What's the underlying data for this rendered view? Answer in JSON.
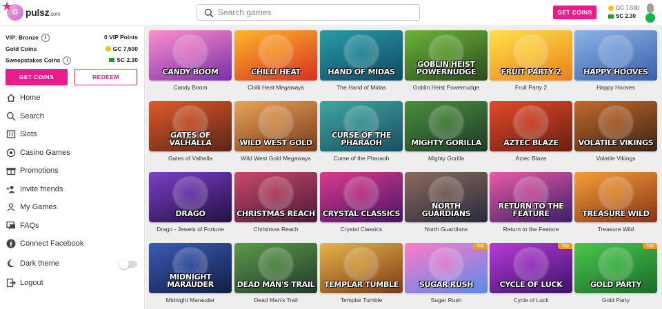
{
  "brand": {
    "logo_text": "pulsz",
    "logo_suffix": ".com",
    "logo_letter": "G"
  },
  "header": {
    "search_placeholder": "Search games",
    "get_coins_label": "GET COINS",
    "gc_balance": "GC 7,500",
    "sc_balance": "SC 2.30"
  },
  "sidebar": {
    "vip_label": "VIP: Bronze",
    "vip_points": "0 VIP Points",
    "gold_label": "Gold Coins",
    "gold_value": "GC 7,500",
    "sweeps_label": "Sweepstakes Coins",
    "sweeps_value": "SC 2.30",
    "get_coins_label": "GET COINS",
    "redeem_label": "REDEEM",
    "items": [
      {
        "label": "Home",
        "icon": "home-icon"
      },
      {
        "label": "Search",
        "icon": "search-icon"
      },
      {
        "label": "Slots",
        "icon": "slots-icon"
      },
      {
        "label": "Casino Games",
        "icon": "casino-chip-icon"
      },
      {
        "label": "Promotions",
        "icon": "gift-icon"
      },
      {
        "label": "Invite friends",
        "icon": "add-user-icon"
      },
      {
        "label": "My Games",
        "icon": "user-icon"
      },
      {
        "label": "FAQs",
        "icon": "faq-icon"
      },
      {
        "label": "Connect Facebook",
        "icon": "facebook-icon"
      },
      {
        "label": "Dark theme",
        "icon": "moon-icon"
      },
      {
        "label": "Logout",
        "icon": "logout-icon"
      }
    ]
  },
  "games": [
    {
      "name": "Candy Boom",
      "title": "CANDY BOOM",
      "bg": [
        "#ff8ecf",
        "#7a2fa8"
      ]
    },
    {
      "name": "Chilli Heat Megaways",
      "title": "CHILLI HEAT",
      "bg": [
        "#ffb52e",
        "#d6321d"
      ]
    },
    {
      "name": "The Hand of Midas",
      "title": "HAND OF MIDAS",
      "bg": [
        "#2a9ba6",
        "#0c4a63"
      ]
    },
    {
      "name": "Goblin Heist Powernudge",
      "title": "GOBLIN HEIST POWERNUDGE",
      "bg": [
        "#6bb53a",
        "#2b4a1a"
      ]
    },
    {
      "name": "Fruit Party 2",
      "title": "FRUIT PARTY 2",
      "bg": [
        "#ffe24a",
        "#e9821a"
      ]
    },
    {
      "name": "Happy Hooves",
      "title": "HAPPY HOOVES",
      "bg": [
        "#8bb4e8",
        "#3a5ea8"
      ]
    },
    {
      "name": "Gates of Valhalla",
      "title": "GATES OF VALHALLA",
      "bg": [
        "#e0582b",
        "#5a2616"
      ]
    },
    {
      "name": "Wild West Gold Megaways",
      "title": "WILD WEST GOLD",
      "bg": [
        "#e8a45a",
        "#7a3a1c"
      ]
    },
    {
      "name": "Curse of the Pharaoh",
      "title": "CURSE OF THE PHARAOH",
      "bg": [
        "#3fa6a0",
        "#1a4e63"
      ]
    },
    {
      "name": "Mighty Gorilla",
      "title": "MIGHTY GORILLA",
      "bg": [
        "#4a8f3c",
        "#1f3a2a"
      ]
    },
    {
      "name": "Aztec Blaze",
      "title": "AZTEC BLAZE",
      "bg": [
        "#e2492b",
        "#6a1f12"
      ]
    },
    {
      "name": "Volatile Vikings",
      "title": "VOLATILE VIKINGS",
      "bg": [
        "#c26a2c",
        "#3e2316"
      ]
    },
    {
      "name": "Drago - Jewels of Fortune",
      "title": "DRAGO",
      "bg": [
        "#7a3fc6",
        "#231044"
      ]
    },
    {
      "name": "Christmas Reach",
      "title": "CHRISTMAS REACH",
      "bg": [
        "#c9486a",
        "#4a1a3a"
      ]
    },
    {
      "name": "Crystal Classics",
      "title": "CRYSTAL CLASSICS",
      "bg": [
        "#d93a8c",
        "#4a1468"
      ]
    },
    {
      "name": "North Guardians",
      "title": "NORTH GUARDIANS",
      "bg": [
        "#8a6a5c",
        "#2a2a3e"
      ]
    },
    {
      "name": "Return to the Feature",
      "title": "RETURN TO THE FEATURE",
      "bg": [
        "#e95aa6",
        "#3a1f6a"
      ]
    },
    {
      "name": "Treasure Wild",
      "title": "TREASURE WILD",
      "bg": [
        "#f2a03a",
        "#8a3214"
      ]
    },
    {
      "name": "Midnight Marauder",
      "title": "MIDNIGHT MARAUDER",
      "bg": [
        "#3a5ab8",
        "#141e44"
      ]
    },
    {
      "name": "Dead Man's Trail",
      "title": "DEAD MAN'S TRAIL",
      "bg": [
        "#5a9a4a",
        "#223a2a"
      ]
    },
    {
      "name": "Templar Tumble",
      "title": "TEMPLAR TUMBLE",
      "bg": [
        "#e8b44a",
        "#7a3a14"
      ]
    },
    {
      "name": "Sugar Rush",
      "title": "SUGAR RUSH",
      "bg": [
        "#ff7acb",
        "#5a8ae8"
      ],
      "badge": "Top"
    },
    {
      "name": "Cycle of Luck",
      "title": "CYCLE OF LUCK",
      "bg": [
        "#b83ad8",
        "#3a1468"
      ],
      "badge": "Top"
    },
    {
      "name": "Gold Party",
      "title": "GOLD PARTY",
      "bg": [
        "#4ac84a",
        "#1a6a2a"
      ],
      "badge": "Top"
    }
  ],
  "colors": {
    "accent": "#ea1b8d",
    "sc_green": "#1f9a3c",
    "gold": "#f2c21a"
  }
}
